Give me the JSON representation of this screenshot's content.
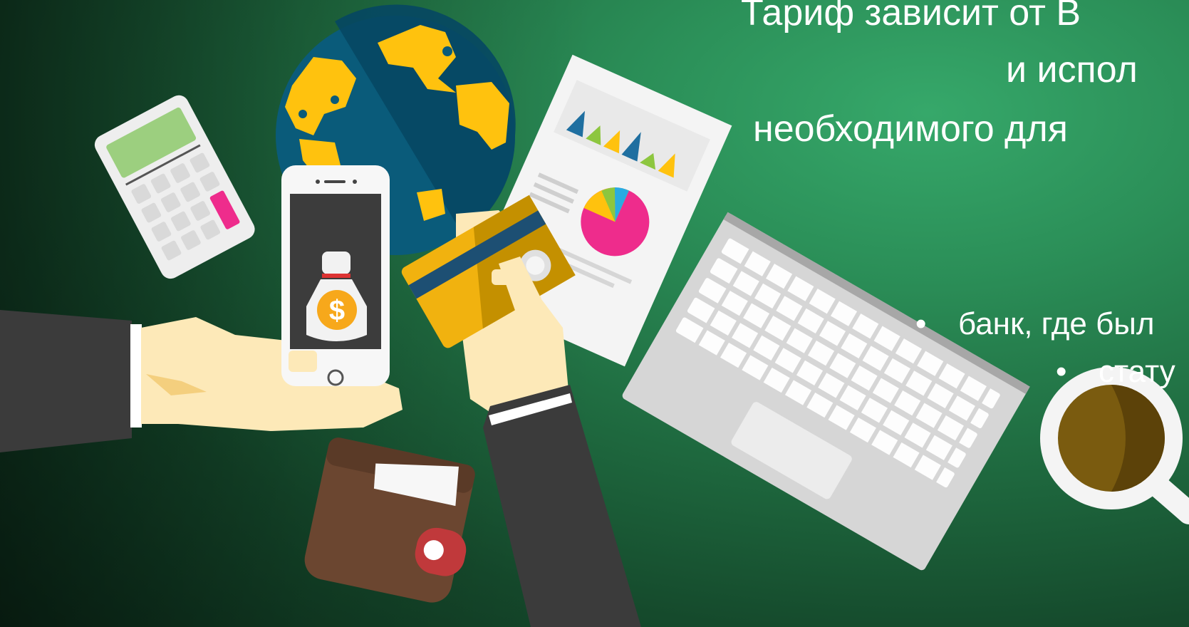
{
  "headline": {
    "line1": "Тариф зависит от В",
    "line2": "и испол",
    "line3": "необходимого для"
  },
  "bullets": [
    {
      "marker": "•",
      "text": "банк, где был"
    },
    {
      "marker": "•",
      "text": "стату"
    }
  ],
  "phone": {
    "currency_symbol": "$"
  },
  "colors": {
    "background_green": "#2b8f58",
    "globe_blue": "#0a5b7a",
    "continent_yellow": "#ffc20e",
    "card_gold": "#f1b20f",
    "wallet_brown": "#6b4630",
    "pie_pink": "#ee2c8c"
  }
}
